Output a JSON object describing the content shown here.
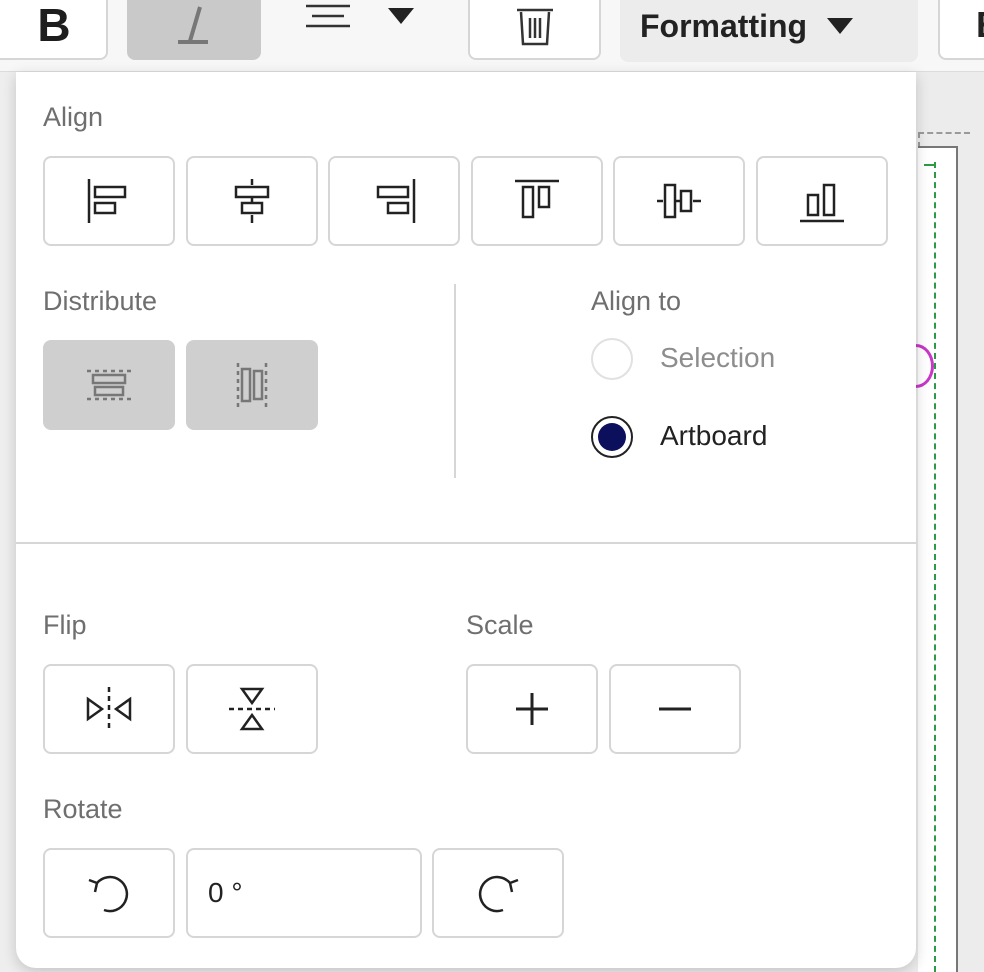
{
  "toolbar": {
    "bold_label": "B",
    "formatting_label": "Formatting",
    "cut_label": "E",
    "icons": [
      "bold-icon",
      "italic-icon",
      "align-text-icon",
      "chevron-down-icon",
      "trash-icon"
    ]
  },
  "panel": {
    "align_label": "Align",
    "align_buttons": [
      "align-left-icon",
      "align-center-horizontal-icon",
      "align-right-icon",
      "align-top-icon",
      "align-middle-vertical-icon",
      "align-bottom-icon"
    ],
    "distribute_label": "Distribute",
    "distribute_buttons": [
      "distribute-vertical-icon",
      "distribute-horizontal-icon"
    ],
    "align_to_label": "Align to",
    "align_to_options": [
      {
        "label": "Selection",
        "selected": false
      },
      {
        "label": "Artboard",
        "selected": true
      }
    ],
    "flip_label": "Flip",
    "scale_label": "Scale",
    "rotate_label": "Rotate",
    "rotate_value": "0 °"
  },
  "colors": {
    "radio_selected": "#0b0f5c",
    "guide": "#2d9b45",
    "selection_handle": "#c837c8"
  }
}
